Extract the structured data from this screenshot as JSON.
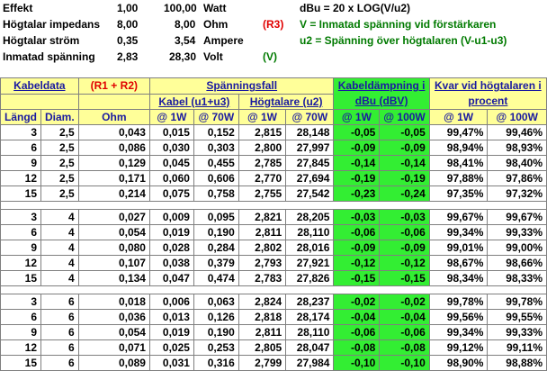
{
  "info": {
    "rows": [
      {
        "label": "Effekt",
        "v1": "1,00",
        "v2": "100,00",
        "unit": "Watt",
        "tag": ""
      },
      {
        "label": "Högtalar impedans",
        "v1": "8,00",
        "v2": "8,00",
        "unit": "Ohm",
        "tag": "(R3)"
      },
      {
        "label": "Högtalar ström",
        "v1": "0,35",
        "v2": "3,54",
        "unit": "Ampere",
        "tag": ""
      },
      {
        "label": "Inmatad spänning",
        "v1": "2,83",
        "v2": "28,30",
        "unit": "Volt",
        "tag": "(V)"
      }
    ],
    "formula": "dBu = 20 x LOG(V/u2)",
    "note_v": "V = Inmatad spänning vid förstärkaren",
    "note_u2": "u2 = Spänning över högtalaren (V-u1-u3)"
  },
  "header": {
    "kabeldata": "Kabeldata",
    "r1r2": "(R1 + R2)",
    "spanningsfall": "Spänningsfall",
    "kabeldampning": "Kabeldämpning i dBu (dBV)",
    "kvar": "Kvar vid högtalaren i procent",
    "langd": "Längd",
    "diam": "Diam.",
    "ohm": "Ohm",
    "kabel": "Kabel (u1+u3)",
    "hogtalare": "Högtalare (u2)",
    "at1w": "@ 1W",
    "at70w": "@ 70W",
    "at100w": "@ 100W"
  },
  "groups": [
    [
      [
        "3",
        "2,5",
        "0,043",
        "0,015",
        "0,152",
        "2,815",
        "28,148",
        "-0,05",
        "-0,05",
        "99,47%",
        "99,46%"
      ],
      [
        "6",
        "2,5",
        "0,086",
        "0,030",
        "0,303",
        "2,800",
        "27,997",
        "-0,09",
        "-0,09",
        "98,94%",
        "98,93%"
      ],
      [
        "9",
        "2,5",
        "0,129",
        "0,045",
        "0,455",
        "2,785",
        "27,845",
        "-0,14",
        "-0,14",
        "98,41%",
        "98,40%"
      ],
      [
        "12",
        "2,5",
        "0,171",
        "0,060",
        "0,606",
        "2,770",
        "27,694",
        "-0,19",
        "-0,19",
        "97,88%",
        "97,86%"
      ],
      [
        "15",
        "2,5",
        "0,214",
        "0,075",
        "0,758",
        "2,755",
        "27,542",
        "-0,23",
        "-0,24",
        "97,35%",
        "97,32%"
      ]
    ],
    [
      [
        "3",
        "4",
        "0,027",
        "0,009",
        "0,095",
        "2,821",
        "28,205",
        "-0,03",
        "-0,03",
        "99,67%",
        "99,67%"
      ],
      [
        "6",
        "4",
        "0,054",
        "0,019",
        "0,190",
        "2,811",
        "28,110",
        "-0,06",
        "-0,06",
        "99,34%",
        "99,33%"
      ],
      [
        "9",
        "4",
        "0,080",
        "0,028",
        "0,284",
        "2,802",
        "28,016",
        "-0,09",
        "-0,09",
        "99,01%",
        "99,00%"
      ],
      [
        "12",
        "4",
        "0,107",
        "0,038",
        "0,379",
        "2,793",
        "27,921",
        "-0,12",
        "-0,12",
        "98,67%",
        "98,66%"
      ],
      [
        "15",
        "4",
        "0,134",
        "0,047",
        "0,474",
        "2,783",
        "27,826",
        "-0,15",
        "-0,15",
        "98,34%",
        "98,33%"
      ]
    ],
    [
      [
        "3",
        "6",
        "0,018",
        "0,006",
        "0,063",
        "2,824",
        "28,237",
        "-0,02",
        "-0,02",
        "99,78%",
        "99,78%"
      ],
      [
        "6",
        "6",
        "0,036",
        "0,013",
        "0,126",
        "2,818",
        "28,174",
        "-0,04",
        "-0,04",
        "99,56%",
        "99,55%"
      ],
      [
        "9",
        "6",
        "0,054",
        "0,019",
        "0,190",
        "2,811",
        "28,110",
        "-0,06",
        "-0,06",
        "99,34%",
        "99,33%"
      ],
      [
        "12",
        "6",
        "0,071",
        "0,025",
        "0,253",
        "2,805",
        "28,047",
        "-0,08",
        "-0,08",
        "99,12%",
        "99,11%"
      ],
      [
        "15",
        "6",
        "0,089",
        "0,031",
        "0,316",
        "2,799",
        "27,984",
        "-0,10",
        "-0,10",
        "98,90%",
        "98,88%"
      ]
    ]
  ]
}
